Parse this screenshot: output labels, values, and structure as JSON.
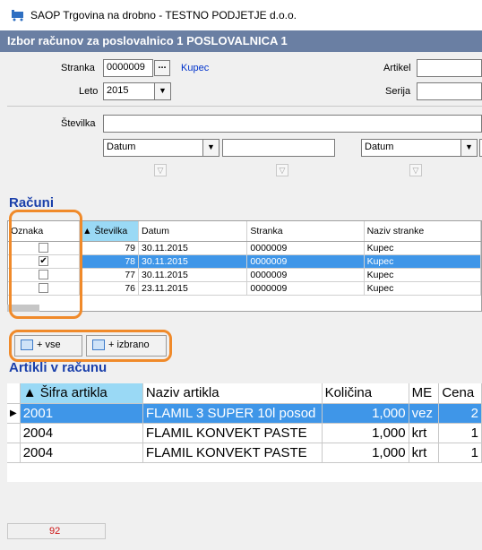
{
  "window": {
    "title": "SAOP Trgovina na drobno - TESTNO PODJETJE d.o.o."
  },
  "header": {
    "title": "Izbor računov za poslovalnico 1 POSLOVALNICA 1"
  },
  "filters": {
    "stranka_label": "Stranka",
    "stranka_value": "0000009",
    "stranka_name": "Kupec",
    "leto_label": "Leto",
    "leto_value": "2015",
    "artikel_label": "Artikel",
    "serija_label": "Serija",
    "stevilka_label": "Številka",
    "datum1": "Datum",
    "datum2": "Datum"
  },
  "racuni": {
    "title": "Računi",
    "columns": [
      "Oznaka",
      "Številka",
      "Datum",
      "Stranka",
      "Naziv stranke"
    ],
    "rows": [
      {
        "checked": false,
        "stevilka": "79",
        "datum": "30.11.2015",
        "stranka": "0000009",
        "naziv": "Kupec"
      },
      {
        "checked": true,
        "stevilka": "78",
        "datum": "30.11.2015",
        "stranka": "0000009",
        "naziv": "Kupec"
      },
      {
        "checked": false,
        "stevilka": "77",
        "datum": "30.11.2015",
        "stranka": "0000009",
        "naziv": "Kupec"
      },
      {
        "checked": false,
        "stevilka": "76",
        "datum": "23.11.2015",
        "stranka": "0000009",
        "naziv": "Kupec"
      }
    ]
  },
  "buttons": {
    "vse": "+ vse",
    "izbrano": "+ izbrano"
  },
  "artikli": {
    "title": "Artikli v računu",
    "columns": [
      "Šifra artikla",
      "Naziv artikla",
      "Količina",
      "ME",
      "Cena"
    ],
    "rows": [
      {
        "sifra": "2001",
        "naziv": "FLAMIL 3 SUPER 10l posod",
        "kolicina": "1,000",
        "me": "vez",
        "cena": "2"
      },
      {
        "sifra": "2004",
        "naziv": "FLAMIL KONVEKT PASTE",
        "kolicina": "1,000",
        "me": "krt",
        "cena": "1"
      },
      {
        "sifra": "2004",
        "naziv": "FLAMIL KONVEKT PASTE",
        "kolicina": "1,000",
        "me": "krt",
        "cena": "1"
      }
    ]
  },
  "status": {
    "count": "92"
  },
  "colors": {
    "header_bg": "#6a7fa3",
    "selection": "#3f96e8",
    "accent_title": "#1a3faa",
    "highlight": "#f08a2a"
  }
}
